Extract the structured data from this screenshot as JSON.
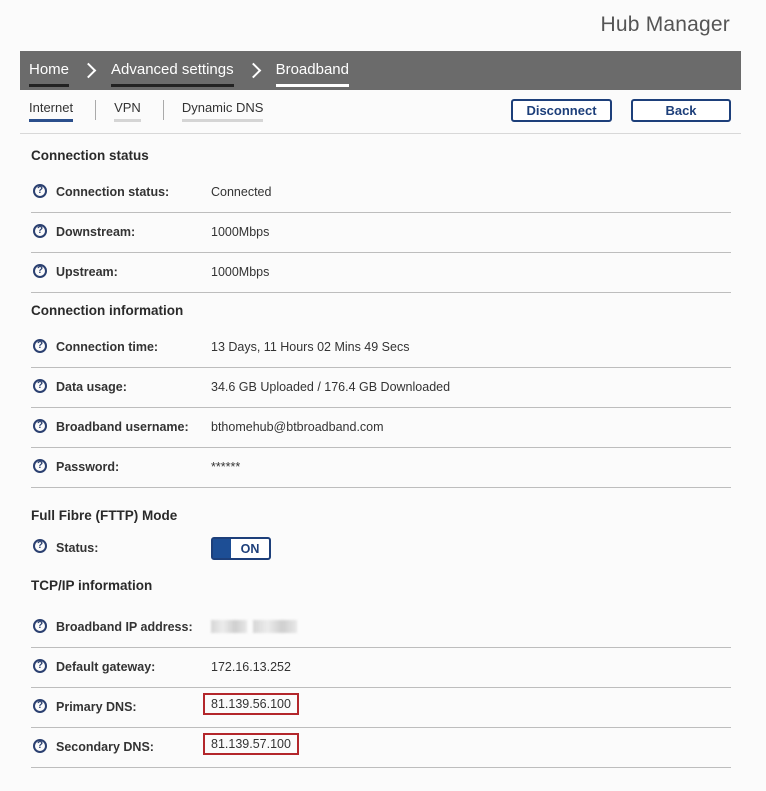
{
  "app": {
    "title": "Hub Manager"
  },
  "breadcrumb": [
    "Home",
    "Advanced settings",
    "Broadband"
  ],
  "tabs": [
    "Internet",
    "VPN",
    "Dynamic DNS"
  ],
  "actions": {
    "disconnect_label": "Disconnect",
    "back_label": "Back"
  },
  "sections": {
    "connection_status": {
      "title": "Connection status",
      "rows": [
        {
          "label": "Connection status:",
          "value": "Connected"
        },
        {
          "label": "Downstream:",
          "value": "1000Mbps"
        },
        {
          "label": "Upstream:",
          "value": "1000Mbps"
        }
      ]
    },
    "connection_information": {
      "title": "Connection information",
      "rows": [
        {
          "label": "Connection time:",
          "value": "13 Days, 11 Hours 02 Mins 49 Secs"
        },
        {
          "label": "Data usage:",
          "value": "34.6 GB Uploaded / 176.4 GB Downloaded"
        },
        {
          "label": "Broadband username:",
          "value": "bthomehub@btbroadband.com"
        },
        {
          "label": "Password:",
          "value": "******"
        }
      ]
    },
    "fttp": {
      "title": "Full Fibre (FTTP) Mode",
      "status_label": "Status:",
      "toggle_label": "ON"
    },
    "tcpip": {
      "title": "TCP/IP information",
      "rows": [
        {
          "label": "Broadband IP address:",
          "value": ""
        },
        {
          "label": "Default gateway:",
          "value": "172.16.13.252"
        },
        {
          "label": "Primary DNS:",
          "value": "81.139.56.100"
        },
        {
          "label": "Secondary DNS:",
          "value": "81.139.57.100"
        }
      ]
    }
  },
  "colors": {
    "accent": "#1d3f7a",
    "highlight": "#b3262b",
    "header_bg": "#6b6b6b"
  },
  "icons": {
    "help": "question-circle-icon",
    "separator": "chevron-right-icon"
  }
}
